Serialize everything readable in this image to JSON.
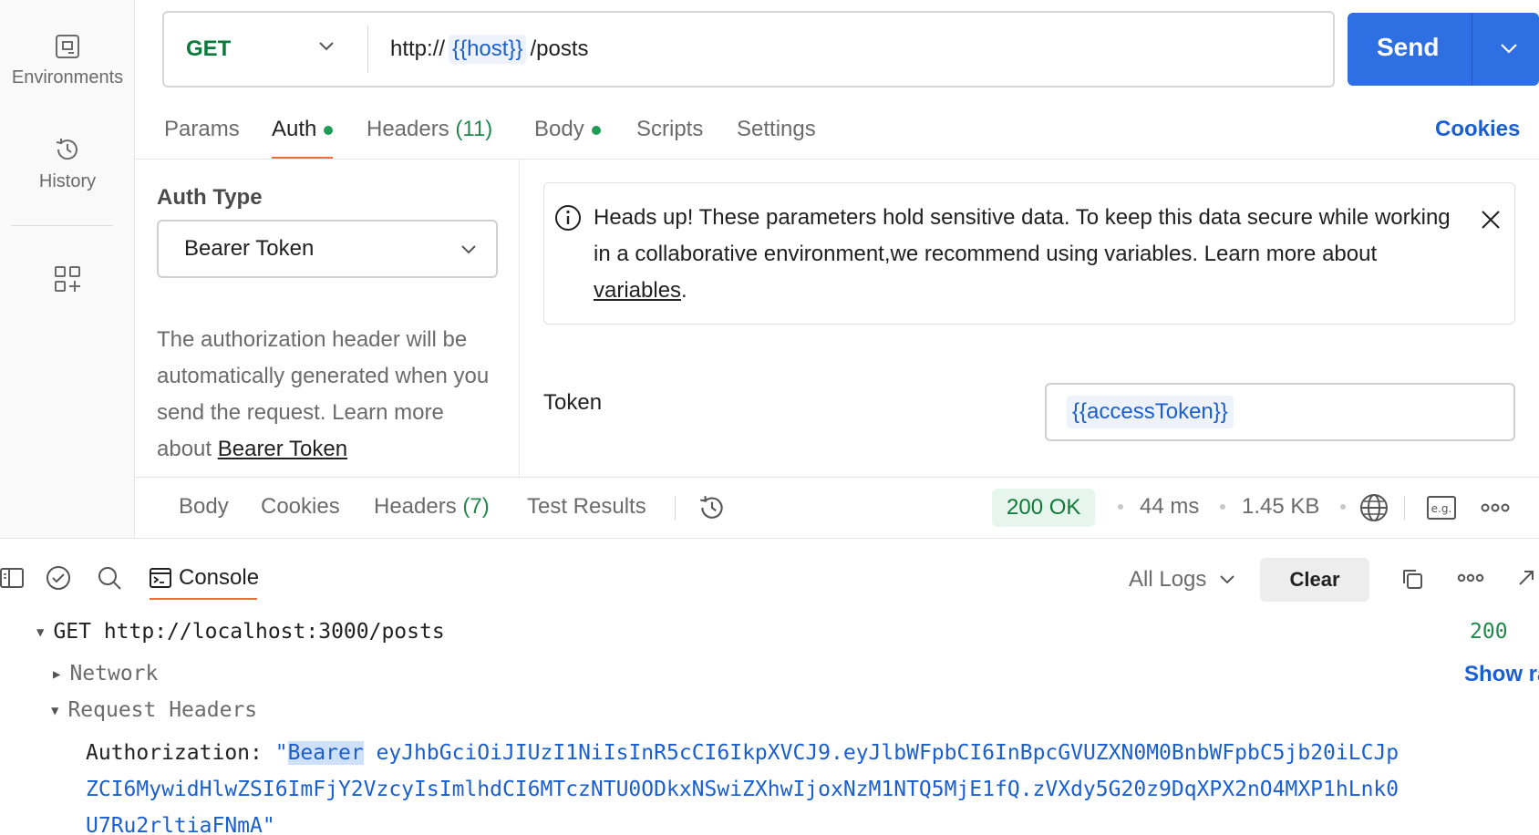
{
  "sidebar": {
    "items": [
      {
        "label": "Environments",
        "icon": "environments-icon"
      },
      {
        "label": "History",
        "icon": "history-icon"
      },
      {
        "label": "",
        "icon": "add-widget-icon"
      }
    ]
  },
  "request": {
    "method": "GET",
    "url_prefix": "http://",
    "url_variable": "{{host}}",
    "url_suffix": "/posts",
    "send_label": "Send"
  },
  "request_tabs": [
    {
      "label": "Params",
      "active": false
    },
    {
      "label": "Auth",
      "active": true,
      "dot": true
    },
    {
      "label": "Headers",
      "count": "(11)",
      "active": false
    },
    {
      "label": "Body",
      "active": false,
      "dot": true
    },
    {
      "label": "Scripts",
      "active": false
    },
    {
      "label": "Settings",
      "active": false
    }
  ],
  "cookies_label": "Cookies",
  "auth": {
    "type_label": "Auth Type",
    "type_value": "Bearer Token",
    "description": "The authorization header will be automatically generated when you send the request. Learn more about ",
    "description_link": "Bearer Token",
    "notice_text": "Heads up! These parameters hold sensitive data. To keep this data secure while working in a collaborative environment,we recommend using variables. Learn more about ",
    "notice_link": "variables",
    "notice_end": ".",
    "token_label": "Token",
    "token_value": "{{accessToken}}"
  },
  "response": {
    "tabs": [
      {
        "label": "Body"
      },
      {
        "label": "Cookies"
      },
      {
        "label": "Headers",
        "count": "(7)"
      },
      {
        "label": "Test Results"
      }
    ],
    "status": "200 OK",
    "time": "44 ms",
    "size": "1.45 KB"
  },
  "console": {
    "tab_label": "Console",
    "filter_label": "All Logs",
    "clear_label": "Clear",
    "request_line": "GET http://localhost:3000/posts",
    "request_status": "200",
    "show_raw_label": "Show ra",
    "network_label": "Network",
    "request_headers_label": "Request Headers",
    "auth_key": "Authorization: ",
    "auth_quote_open": "\"",
    "auth_bearer": "Bearer",
    "auth_token_line1": " eyJhbGciOiJIUzI1NiIsInR5cCI6IkpXVCJ9.eyJlbWFpbCI6InBpcGVUZXN0M0BnbWFpbC5jb20iLCJp",
    "auth_token_line2": "ZCI6MywidHlwZSI6ImFjY2VzcyIsImlhdCI6MTczNTU0ODkxNSwiZXhwIjoxNzM1NTQ5MjE1fQ.zVXdy5G20z9DqXPX2nO4MXP1hLnk0",
    "auth_token_line3": "U7Ru2rltiaFNmA",
    "auth_quote_close": "\""
  },
  "colors": {
    "accent_blue": "#2f6fe4",
    "method_green": "#0b7a3b",
    "tab_underline": "#f26b3a",
    "status_green": "#107a3a"
  }
}
